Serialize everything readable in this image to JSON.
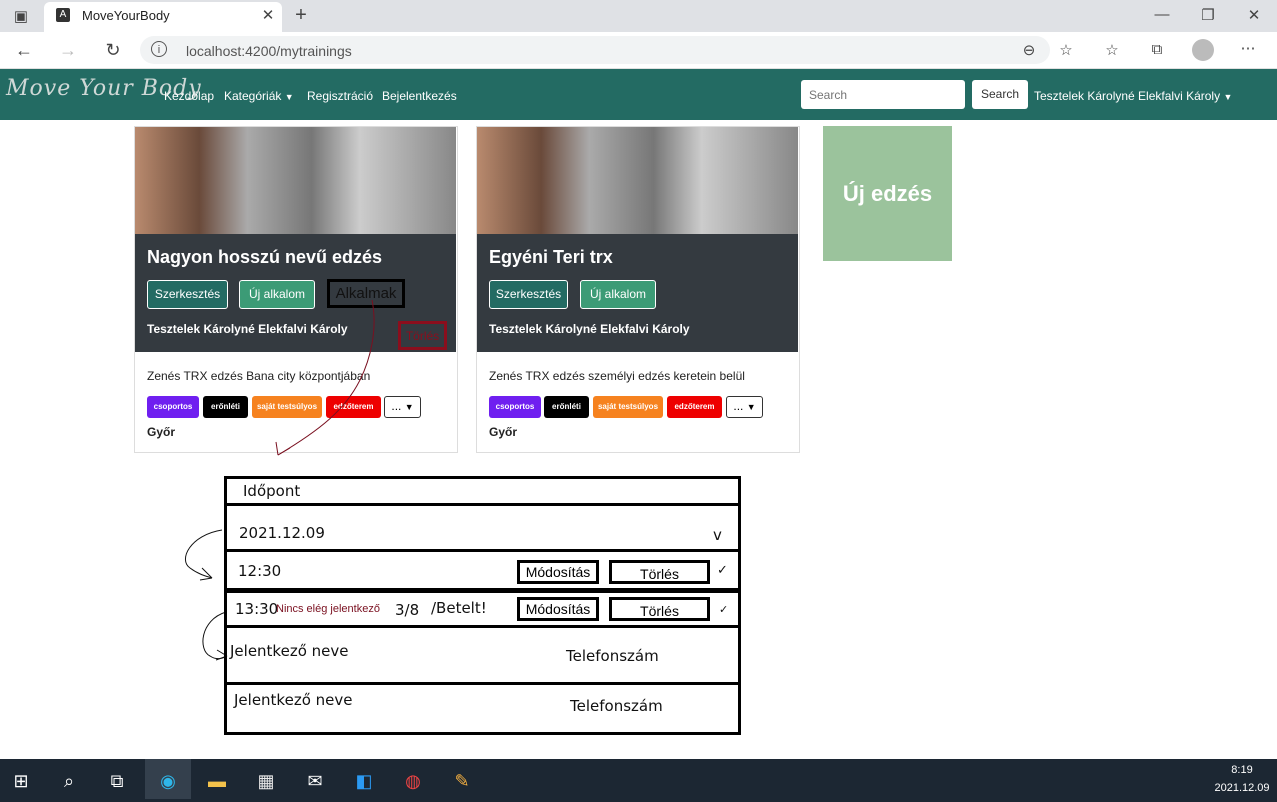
{
  "browser": {
    "tab_title": "MoveYourBody",
    "url": "localhost:4200/mytrainings"
  },
  "nav": {
    "brand": "Move Your Body",
    "links": [
      "Kezdőlap",
      "Kategóriák",
      "Regisztráció",
      "Bejelentkezés"
    ],
    "search_placeholder": "Search",
    "search_button": "Search",
    "user": "Tesztelek Károlyné Elekfalvi Károly"
  },
  "cards": [
    {
      "title": "Nagyon hosszú nevű edzés",
      "edit": "Szerkesztés",
      "new_session": "Új alkalom",
      "sessions": "Alkalmak",
      "delete": "Törlés",
      "owner": "Tesztelek Károlyné Elekfalvi Károly",
      "description": "Zenés TRX edzés Bana city központjában",
      "tags": [
        "csoportos",
        "erőnléti",
        "saját testsúlyos",
        "edzőterem"
      ],
      "more": "...",
      "city": "Győr"
    },
    {
      "title": "Egyéni Teri trx",
      "edit": "Szerkesztés",
      "new_session": "Új alkalom",
      "owner": "Tesztelek Károlyné Elekfalvi Károly",
      "description": "Zenés TRX edzés személyi edzés keretein belül",
      "tags": [
        "csoportos",
        "erőnléti",
        "saját testsúlyos",
        "edzőterem"
      ],
      "more": "...",
      "city": "Győr"
    }
  ],
  "new_training": "Új edzés",
  "sketch": {
    "header": "Időpont",
    "date": "2021.12.09",
    "rows": [
      {
        "time": "12:30",
        "modify": "Módosítás",
        "delete": "Törlés"
      },
      {
        "time": "13:30",
        "note": "Nincs elég jelentkező",
        "count": "3/8",
        "full": "/Betelt!",
        "modify": "Módosítás",
        "delete": "Törlés"
      }
    ],
    "participants": [
      {
        "name": "Jelentkező neve",
        "phone": "Telefonszám"
      },
      {
        "name": "Jelentkező neve",
        "phone": "Telefonszám"
      }
    ]
  },
  "taskbar": {
    "time": "8:19",
    "date": "2021.12.09"
  },
  "colors": {
    "navbar": "#236b63",
    "card_dark": "#343a40",
    "green_button": "#3c9b76",
    "new_training": "#9bc39c",
    "tag_colors": [
      "#6f1ff0",
      "#000000",
      "#f6821f",
      "#ee0000"
    ]
  }
}
